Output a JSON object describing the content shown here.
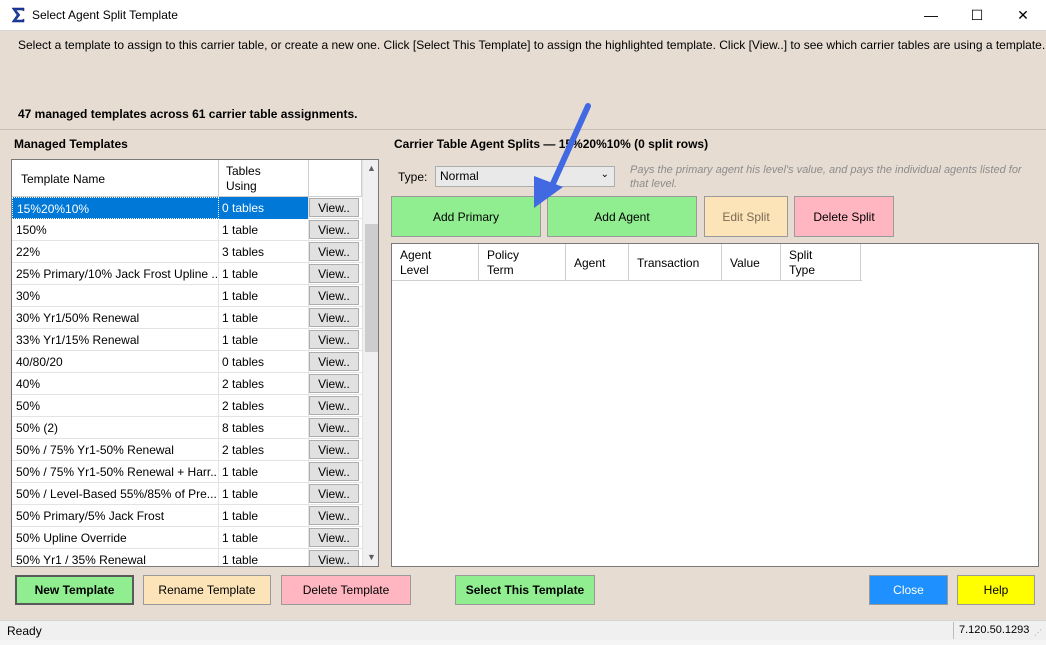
{
  "window": {
    "title": "Select Agent Split Template",
    "min_glyph": "—",
    "max_glyph": "☐",
    "close_glyph": "✕"
  },
  "instructions": "Select a template to assign to this carrier table, or create a new one. Click [Select This Template] to assign the highlighted template. Click [View..] to see which carrier tables are using a template.",
  "summary": "47 managed templates across 61 carrier table assignments.",
  "templates": {
    "title": "Managed Templates",
    "col_name": "Template Name",
    "col_tables_line1": "Tables",
    "col_tables_line2": "Using",
    "view_label": "View..",
    "selected_index": 0,
    "rows": [
      {
        "name": "15%20%10%",
        "tables": "0 tables"
      },
      {
        "name": "150%",
        "tables": "1 table"
      },
      {
        "name": "22%",
        "tables": "3 tables"
      },
      {
        "name": "25% Primary/10% Jack Frost Upline ...",
        "tables": "1 table"
      },
      {
        "name": "30%",
        "tables": "1 table"
      },
      {
        "name": "30% Yr1/50% Renewal",
        "tables": "1 table"
      },
      {
        "name": "33% Yr1/15% Renewal",
        "tables": "1 table"
      },
      {
        "name": "40/80/20",
        "tables": "0 tables"
      },
      {
        "name": "40%",
        "tables": "2 tables"
      },
      {
        "name": "50%",
        "tables": "2 tables"
      },
      {
        "name": "50% (2)",
        "tables": "8 tables"
      },
      {
        "name": "50% / 75% Yr1-50% Renewal",
        "tables": "2 tables"
      },
      {
        "name": "50% / 75% Yr1-50% Renewal + Harr...",
        "tables": "1 table"
      },
      {
        "name": "50% / Level-Based 55%/85% of Pre...",
        "tables": "1 table"
      },
      {
        "name": "50% Primary/5% Jack Frost",
        "tables": "1 table"
      },
      {
        "name": "50% Upline Override",
        "tables": "1 table"
      },
      {
        "name": "50% Yr1 / 35% Renewal",
        "tables": "1 table"
      }
    ]
  },
  "splits": {
    "title": "Carrier Table Agent Splits — 15%20%10%  (0 split rows)",
    "type_label": "Type:",
    "type_value": "Normal",
    "type_description": "Pays the primary agent his level's value, and pays the individual agents listed for that level.",
    "add_primary": "Add Primary",
    "add_agent": "Add Agent",
    "edit_split": "Edit Split",
    "delete_split": "Delete Split",
    "columns": [
      {
        "line1": "Agent",
        "line2": "Level"
      },
      {
        "line1": "Policy",
        "line2": "Term"
      },
      {
        "line1": "Agent",
        "line2": ""
      },
      {
        "line1": "Transaction",
        "line2": ""
      },
      {
        "line1": "Value",
        "line2": ""
      },
      {
        "line1": "Split",
        "line2": "Type"
      }
    ]
  },
  "footer": {
    "new_template": "New Template",
    "rename_template": "Rename Template",
    "delete_template": "Delete Template",
    "select_template": "Select This Template",
    "close": "Close",
    "help": "Help"
  },
  "status": {
    "text": "Ready",
    "version": "7.120.50.1293"
  },
  "colors": {
    "accent_green": "#90ee90",
    "accent_peach": "#fce4b8",
    "accent_pink": "#ffb6c1",
    "accent_blue": "#1e90ff",
    "accent_yellow": "#ffff00",
    "selection": "#0078d7",
    "annotation_arrow": "#4169e1"
  },
  "icons": {
    "app": "sigma-app-icon",
    "dropdown": "chevron-down-icon",
    "scroll_up": "scroll-up-icon",
    "scroll_down": "scroll-down-icon",
    "annotation": "arrow-annotation-icon"
  }
}
